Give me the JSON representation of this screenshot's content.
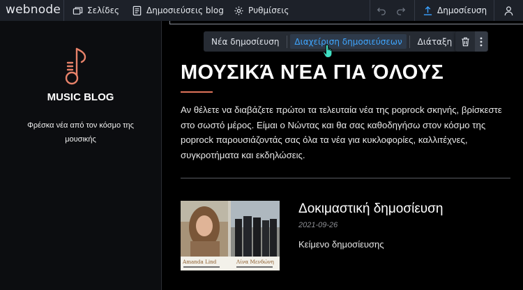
{
  "topbar": {
    "logo": "webnode",
    "pages_label": "Σελίδες",
    "posts_label": "Δημοσιεύσεις blog",
    "settings_label": "Ρυθμίσεις",
    "publish_label": "Δημοσίευση",
    "icons": {
      "pages": "pages-icon",
      "posts": "document-icon",
      "settings": "gear-icon",
      "undo": "undo-icon",
      "redo": "redo-icon",
      "publish": "upload-icon",
      "user": "user-icon"
    }
  },
  "sidebar": {
    "icon": "music-note-icon",
    "blog_title": "MUSIC BLOG",
    "subtitle": "Φρέσκα νέα από τον κόσμο της μουσικής"
  },
  "edit_toolbar": {
    "new_post": "Νέα δημοσίευση",
    "manage_posts": "Διαχείριση δημοσιεύσεων",
    "layout": "Διάταξη",
    "delete_icon": "trash-icon",
    "more_icon": "more-vertical-icon"
  },
  "main": {
    "title": "ΜΟΥΣΙΚΆ ΝΈΑ ΓΙΑ ΌΛΟΥΣ",
    "intro": "Αν θέλετε να διαβάζετε πρώτοι τα τελευταία νέα της poprock σκηνής, βρίσκεστε στο σωστό μέρος. Είμαι ο Νώντας και θα σας καθοδηγήσω στον κόσμο της poprock παρουσιάζοντάς σας όλα τα νέα για κυκλοφορίες, καλλιτέχνες, συγκροτήματα και εκδηλώσεις.",
    "post": {
      "title": "Δοκιμαστική δημοσίευση",
      "date": "2021-09-26",
      "body": "Κείμενο δημοσίευσης",
      "image_caption_left": "Amanda Lind",
      "image_caption_right": "Λίνα Μενδώνη"
    }
  },
  "colors": {
    "topbar_bg": "#1d2129",
    "accent_blue": "#3fa6ff",
    "note_orange": "#e8826a",
    "rule_orange": "#e0745a"
  }
}
